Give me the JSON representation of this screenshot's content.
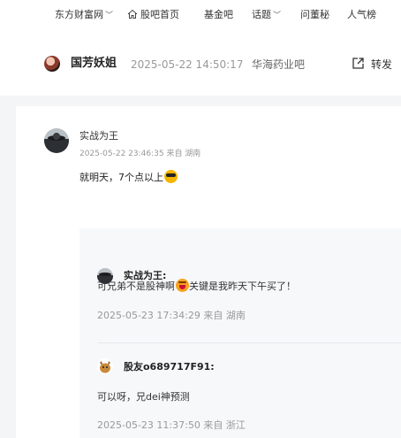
{
  "nav": {
    "items": [
      {
        "label": "东方财富网",
        "dropdown": true
      },
      {
        "label": "股吧首页",
        "icon": "home-icon"
      },
      {
        "label": "基金吧"
      },
      {
        "label": "话题",
        "dropdown": true
      },
      {
        "label": "问董秘"
      },
      {
        "label": "人气榜"
      }
    ]
  },
  "post": {
    "author": "国芳妖姐",
    "time": "2025-05-22 14:50:17",
    "forum": "华海药业吧",
    "share_label": "转发"
  },
  "comment": {
    "author": "实战为王",
    "meta": "2025-05-22 23:46:35  来自 湖南",
    "text": "就明天，7个点以上",
    "emoji": "sunglasses-emoji"
  },
  "replies": [
    {
      "author": "实战为王:",
      "text_before": "可兄弟不是股神啊",
      "emoji": "laughing-emoji",
      "text_after": "关键是我昨天下午买了！",
      "meta": "2025-05-23 17:34:29  来自 湖南"
    },
    {
      "author": "股友o689717F91:",
      "text": "可以呀，兄dei神预测",
      "meta": "2025-05-23 11:37:50  来自 浙江"
    }
  ],
  "colors": {
    "background": "#ffffff",
    "gutter": "#f4f5f7",
    "reply_box": "#f7f8fa",
    "muted_text": "#999999"
  }
}
